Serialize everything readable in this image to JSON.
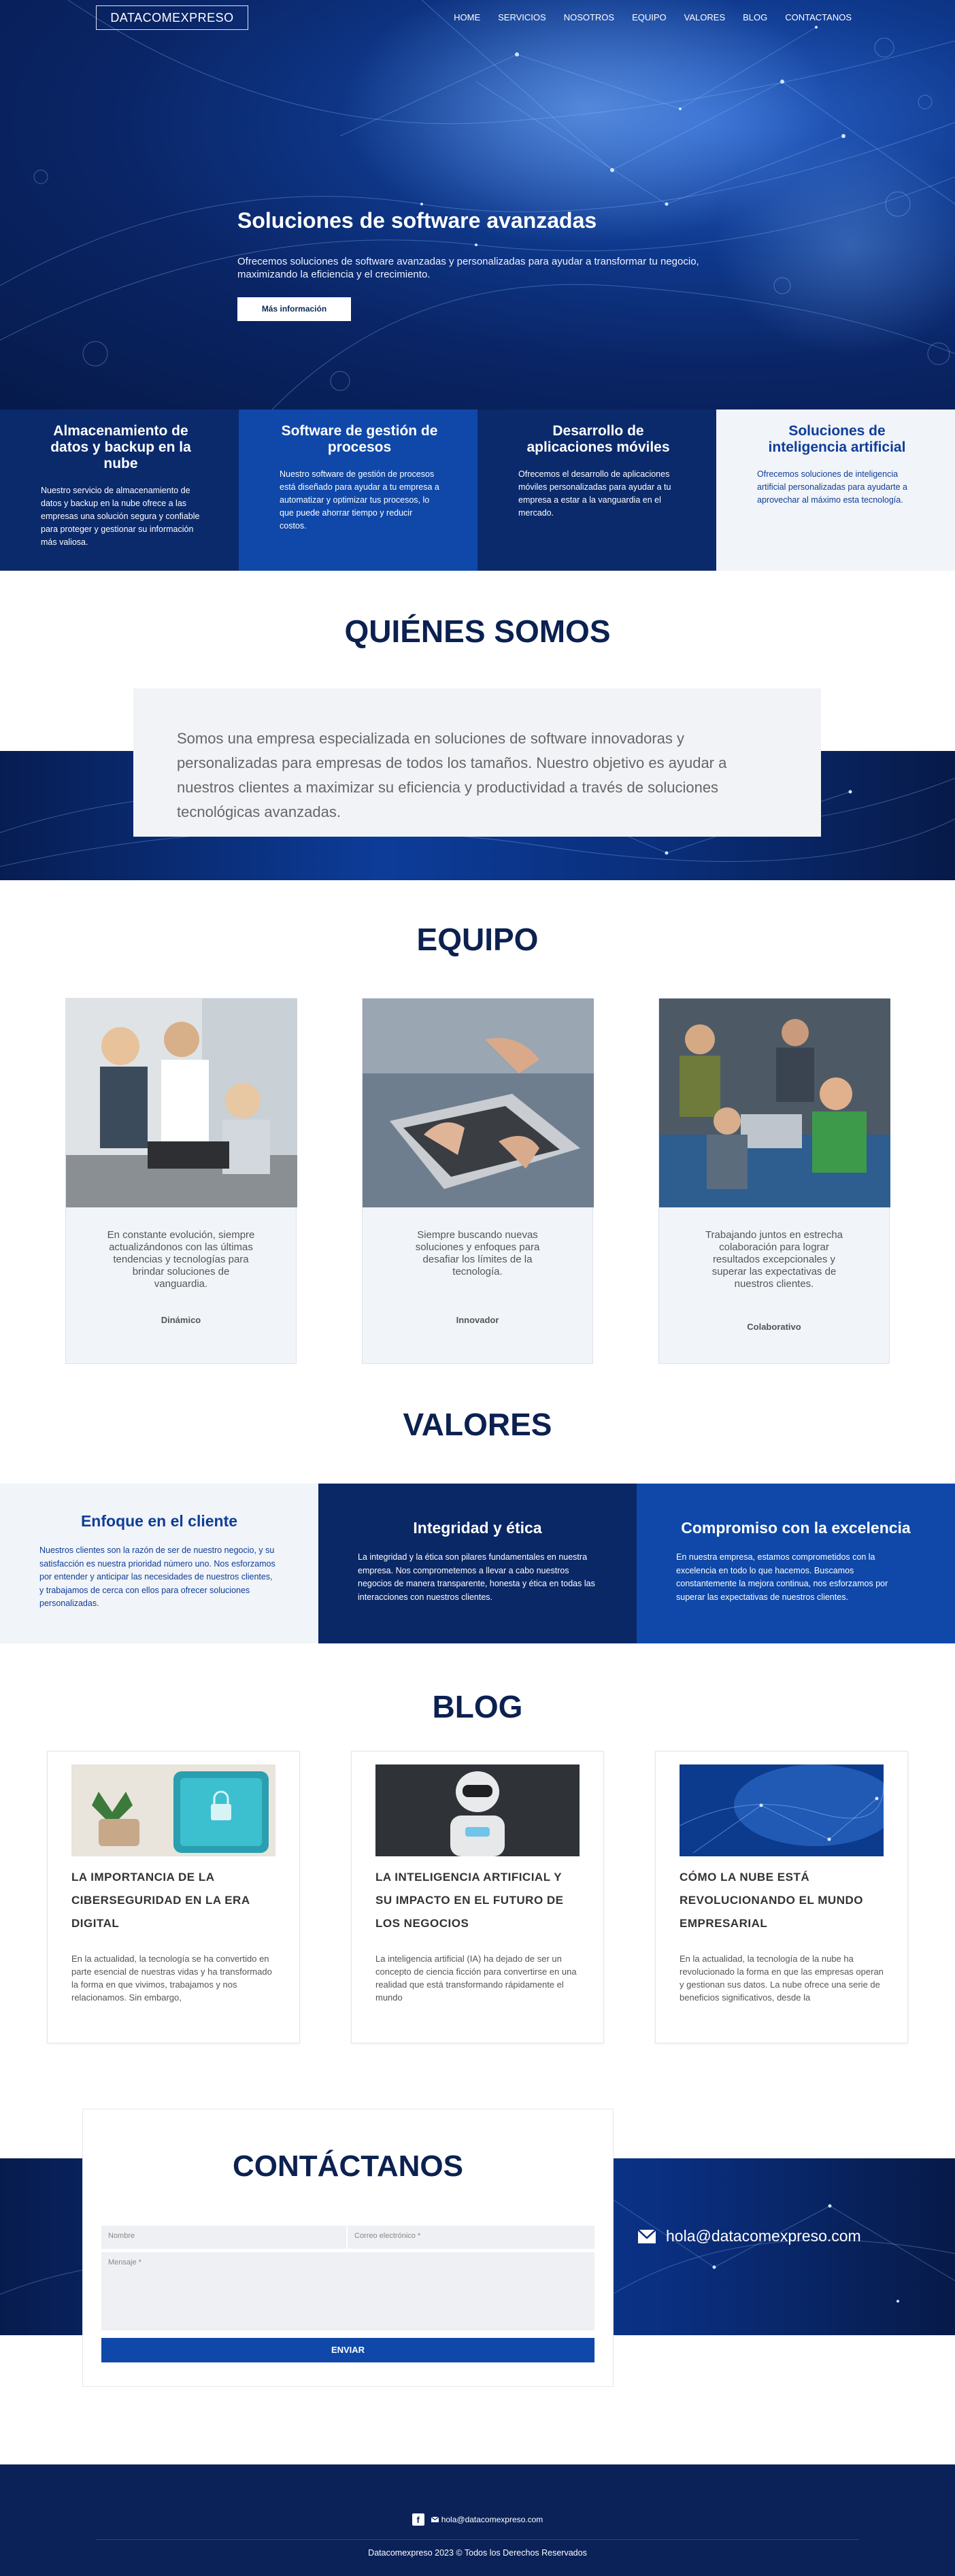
{
  "nav": {
    "logo": "DATACOMEXPRESO",
    "items": [
      "HOME",
      "SERVICIOS",
      "NOSOTROS",
      "EQUIPO",
      "VALORES",
      "BLOG",
      "CONTACTANOS"
    ]
  },
  "hero": {
    "title": "Soluciones de software avanzadas",
    "subtitle": "Ofrecemos soluciones de software avanzadas y personalizadas para ayudar a transformar tu negocio, maximizando la eficiencia y el crecimiento.",
    "button": "Más información"
  },
  "services": [
    {
      "title": "Almacenamiento de datos y backup en la nube",
      "text": "Nuestro servicio de almacenamiento de datos y backup en la nube ofrece a las empresas una solución segura y confiable para proteger y gestionar su información más valiosa."
    },
    {
      "title": "Software de gestión de procesos",
      "text": "Nuestro software de gestión de procesos está diseñado para ayudar a tu empresa a automatizar y optimizar tus procesos, lo que puede ahorrar tiempo y reducir costos."
    },
    {
      "title": "Desarrollo de aplicaciones móviles",
      "text": "Ofrecemos el desarrollo de aplicaciones móviles personalizadas para ayudar a tu empresa a estar a la vanguardia en el mercado."
    },
    {
      "title": "Soluciones de inteligencia artificial",
      "text": "Ofrecemos soluciones de inteligencia artificial personalizadas para ayudarte a aprovechar al máximo esta tecnología."
    }
  ],
  "about": {
    "title": "QUIÉNES SOMOS",
    "text": "Somos una empresa especializada en soluciones de software innovadoras y personalizadas para empresas de todos los tamaños. Nuestro objetivo es ayudar a nuestros clientes a maximizar su eficiencia y productividad a través de soluciones tecnológicas avanzadas."
  },
  "team": {
    "title": "EQUIPO",
    "members": [
      {
        "text": "En constante evolución, siempre actualizándonos con las últimas tendencias y tecnologías para brindar soluciones de vanguardia.",
        "label": "Dinámico"
      },
      {
        "text": "Siempre buscando nuevas soluciones y enfoques para desafiar los límites de la tecnología.",
        "label": "Innovador"
      },
      {
        "text": "Trabajando juntos en estrecha colaboración para lograr resultados excepcionales y superar las expectativas de nuestros clientes.",
        "label": "Colaborativo"
      }
    ]
  },
  "values": {
    "title": "VALORES",
    "items": [
      {
        "title": "Enfoque en el cliente",
        "text": "Nuestros clientes son la razón de ser de nuestro negocio, y su satisfacción es nuestra prioridad número uno. Nos esforzamos por entender y anticipar las necesidades de nuestros clientes, y trabajamos de cerca con ellos para ofrecer soluciones personalizadas."
      },
      {
        "title": "Integridad y ética",
        "text": "La integridad y la ética son pilares fundamentales en nuestra empresa. Nos comprometemos a llevar a cabo nuestros negocios de manera transparente, honesta y ética en todas las interacciones con nuestros clientes."
      },
      {
        "title": "Compromiso con la excelencia",
        "text": "En nuestra empresa, estamos comprometidos con la excelencia en todo lo que hacemos. Buscamos constantemente la mejora continua, nos esforzamos por superar las expectativas de nuestros clientes."
      }
    ]
  },
  "blog": {
    "title": "BLOG",
    "posts": [
      {
        "title": "LA IMPORTANCIA DE LA CIBERSEGURIDAD EN LA ERA DIGITAL",
        "excerpt": "En la actualidad, la tecnología se ha convertido en parte esencial de nuestras vidas y ha transformado la forma en que vivimos, trabajamos y nos relacionamos. Sin embargo,"
      },
      {
        "title": "LA INTELIGENCIA ARTIFICIAL Y SU IMPACTO EN EL FUTURO DE LOS NEGOCIOS",
        "excerpt": "La inteligencia artificial (IA) ha dejado de ser un concepto de ciencia ficción para convertirse en una realidad que está transformando rápidamente el mundo"
      },
      {
        "title": "CÓMO LA NUBE ESTÁ REVOLUCIONANDO EL MUNDO EMPRESARIAL",
        "excerpt": "En la actualidad, la tecnología de la nube ha revolucionado la forma en que las empresas operan y gestionan sus datos. La nube ofrece una serie de beneficios significativos, desde la"
      }
    ]
  },
  "contact": {
    "title": "CONTÁCTANOS",
    "name_placeholder": "Nombre",
    "email_placeholder": "Correo electrónico *",
    "message_placeholder": "Mensaje *",
    "submit": "ENVIAR",
    "email": "hola@datacomexpreso.com"
  },
  "footer": {
    "facebook_icon": "f",
    "email": "hola@datacomexpreso.com",
    "copyright": "Datacomexpreso 2023 © Todos los Derechos Reservados"
  }
}
